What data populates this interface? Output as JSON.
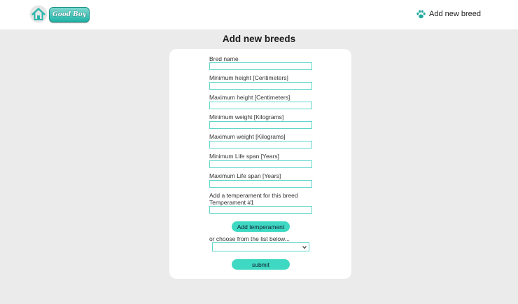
{
  "header": {
    "logo_text": "Good Boy",
    "nav_add_breed": "Add new breed"
  },
  "page": {
    "title": "Add new breeds"
  },
  "form": {
    "breed_name_label": "Bred name",
    "breed_name_value": "",
    "min_height_label": "Minimum height [Centimeters]",
    "min_height_value": "",
    "max_height_label": "Maximum height [Centimeters]",
    "max_height_value": "",
    "min_weight_label": "Minimum weight [Kilograms]",
    "min_weight_value": "",
    "max_weight_label": "Maximum weight [Kilograms]",
    "max_weight_value": "",
    "min_life_label": "Minimum Life span [Years]",
    "min_life_value": "",
    "max_life_label": "Maximum Life span [Years]",
    "max_life_value": "",
    "temperament_heading": "Add a temperament for this breed",
    "temperament_1_label": "Temperament #1",
    "temperament_1_value": "",
    "add_temperament_button": "Add temperament",
    "choose_list_label": "or choose from the list below...",
    "temperament_select_value": "",
    "submit_button": "submit"
  },
  "colors": {
    "accent": "#3ed8c3",
    "input_border": "#5fd6cc",
    "page_background": "#ebebeb"
  },
  "icons": {
    "home": "home-icon",
    "paw": "paw-icon",
    "dropdown": "chevron-down-icon"
  }
}
